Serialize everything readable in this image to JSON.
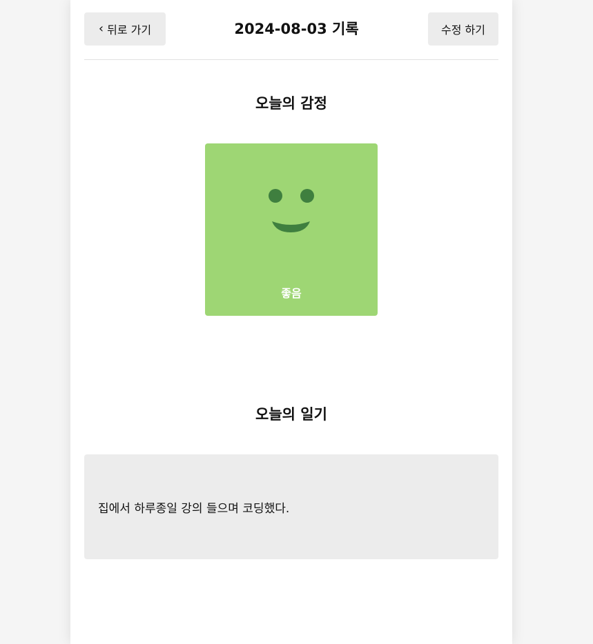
{
  "header": {
    "back_icon": "chevron-left-icon",
    "back_label": "뒤로 가기",
    "title": "2024-08-03 기록",
    "edit_label": "수정 하기"
  },
  "emotion": {
    "section_title": "오늘의 감정",
    "label": "좋음",
    "icon": "smile-face-icon",
    "card_color": "#9ed674",
    "face_color": "#3f7f3f"
  },
  "diary": {
    "section_title": "오늘의 일기",
    "content": "집에서 하루종일 강의 들으며 코딩했다."
  }
}
